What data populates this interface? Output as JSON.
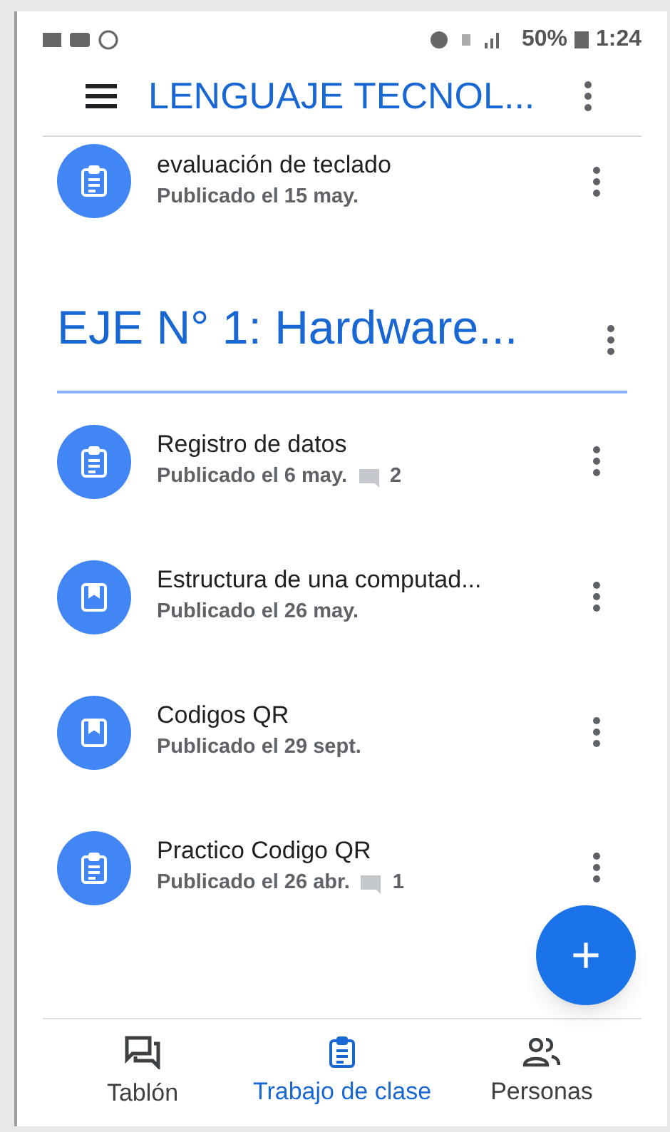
{
  "status_bar": {
    "battery": "50%",
    "time": "1:24"
  },
  "app_bar": {
    "title": "LENGUAJE TECNOL..."
  },
  "sections": [
    {
      "items": [
        {
          "kind": "assignment",
          "title": "evaluación de teclado",
          "posted": "Publicado el 15 may."
        }
      ]
    },
    {
      "title": "EJE N° 1: Hardware...",
      "items": [
        {
          "kind": "assignment",
          "title": "Registro de datos",
          "posted": "Publicado el 6 may.",
          "comments": "2"
        },
        {
          "kind": "material",
          "title": "Estructura de una computad...",
          "posted": "Publicado el 26 may."
        },
        {
          "kind": "material",
          "title": "Codigos QR",
          "posted": "Publicado el 29 sept."
        },
        {
          "kind": "assignment",
          "title": "Practico Codigo QR",
          "posted": "Publicado el 26 abr.",
          "comments": "1"
        }
      ]
    }
  ],
  "fab": {
    "label": "+"
  },
  "bottom_nav": [
    {
      "kind": "stream",
      "label": "Tablón",
      "selected": false
    },
    {
      "kind": "classwork",
      "label": "Trabajo de clase",
      "selected": true
    },
    {
      "kind": "people",
      "label": "Personas",
      "selected": false
    }
  ]
}
